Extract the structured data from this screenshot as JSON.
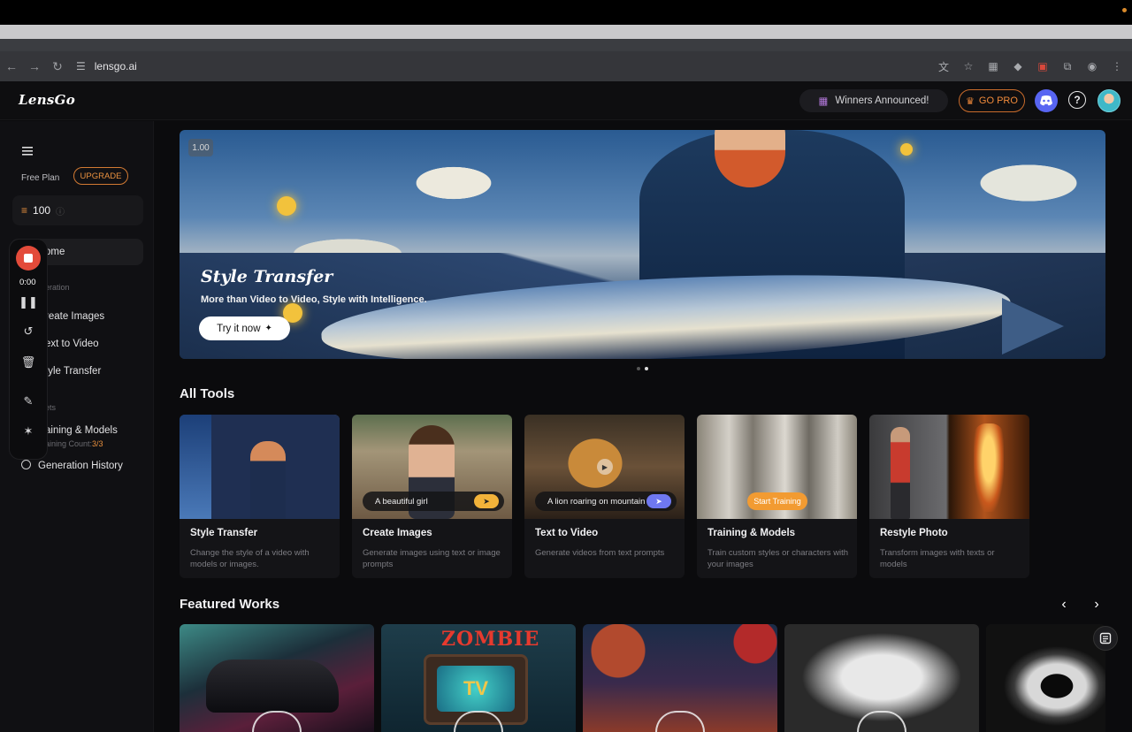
{
  "browser": {
    "url": "lensgo.ai"
  },
  "header": {
    "logo": "LensGo",
    "winners": "Winners Announced!",
    "go_pro": "GO PRO"
  },
  "sidebar": {
    "free_plan": "Free Plan",
    "upgrade": "UPGRADE",
    "credits": "100",
    "items": [
      {
        "label": "ome"
      },
      {
        "label": "eration"
      },
      {
        "label": "reate Images"
      },
      {
        "label": "ext to Video"
      },
      {
        "label": "tyle Transfer"
      },
      {
        "label": "ets"
      },
      {
        "label": "aining & Models"
      },
      {
        "label": "aining Count:",
        "count": "3/3"
      },
      {
        "label": "Generation History"
      }
    ]
  },
  "recorder": {
    "time": "0:00"
  },
  "hero": {
    "badge": "1.00",
    "title": "Style Transfer",
    "subtitle": "More than Video to Video, Style with Intelligence.",
    "button": "Try it now"
  },
  "all_tools": {
    "title": "All Tools",
    "cards": [
      {
        "title": "Style Transfer",
        "desc": "Change the style of a video with models or images."
      },
      {
        "title": "Create Images",
        "desc": "Generate images using text or image prompts",
        "prompt": "A beautiful girl"
      },
      {
        "title": "Text to Video",
        "desc": "Generate videos from text prompts",
        "prompt": "A lion roaring on mountain"
      },
      {
        "title": "Training & Models",
        "desc": "Train custom styles or characters with your images",
        "cta": "Start Training"
      },
      {
        "title": "Restyle Photo",
        "desc": "Transform images with texts or models"
      }
    ]
  },
  "featured": {
    "title": "Featured Works",
    "items": [
      {
        "text": ""
      },
      {
        "text": "ZOMBIE",
        "sub": "TV"
      },
      {
        "text": ""
      },
      {
        "text": ""
      },
      {
        "text": ""
      }
    ]
  },
  "colors": {
    "accent_orange": "#f08a3b",
    "discord": "#5865f2",
    "record_red": "#e34b3a"
  }
}
